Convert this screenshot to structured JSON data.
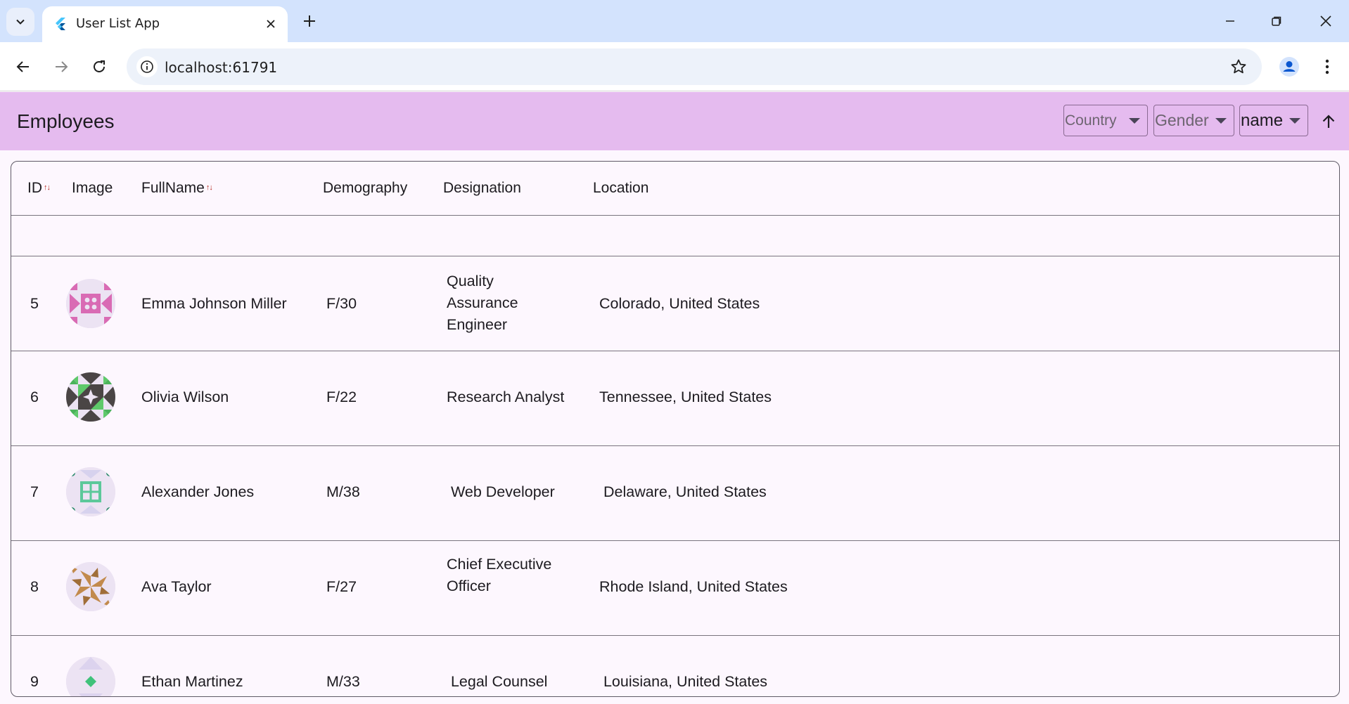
{
  "browser": {
    "tab_title": "User List App",
    "url": "localhost:61791"
  },
  "appbar": {
    "title": "Employees",
    "filters": {
      "country": "Country",
      "gender": "Gender",
      "sort_field": "name"
    }
  },
  "table": {
    "headers": {
      "id": "ID",
      "image": "Image",
      "fullname": "FullName",
      "demography": "Demography",
      "designation": "Designation",
      "location": "Location"
    },
    "sort_up_glyph": "↑",
    "sort_down_glyph": "↓",
    "rows": [
      {
        "id": "5",
        "name": "Emma Johnson Miller",
        "demo": "F/30",
        "designation_lines": [
          "Quality",
          "Assurance",
          "Engineer"
        ],
        "location": "Colorado, United States",
        "avatar_icon": "quilt-pink-icon"
      },
      {
        "id": "6",
        "name": "Olivia  Wilson",
        "demo": "F/22",
        "designation_lines": [
          "Research Analyst"
        ],
        "location": "Tennessee, United States",
        "avatar_icon": "quilt-green-dark-icon"
      },
      {
        "id": "7",
        "name": "Alexander  Jones",
        "demo": "M/38",
        "designation_lines": [
          " Web Developer"
        ],
        "location": " Delaware, United States",
        "avatar_icon": "quilt-green-window-icon"
      },
      {
        "id": "8",
        "name": "Ava  Taylor",
        "demo": "F/27",
        "designation_lines": [
          "Chief Executive",
          "Officer"
        ],
        "location": "Rhode Island, United States",
        "avatar_icon": "quilt-tan-pinwheel-icon"
      },
      {
        "id": "9",
        "name": "Ethan  Martinez",
        "demo": "M/33",
        "designation_lines": [
          " Legal Counsel"
        ],
        "location": " Louisiana, United States",
        "avatar_icon": "quilt-green-diamond-icon"
      }
    ]
  }
}
